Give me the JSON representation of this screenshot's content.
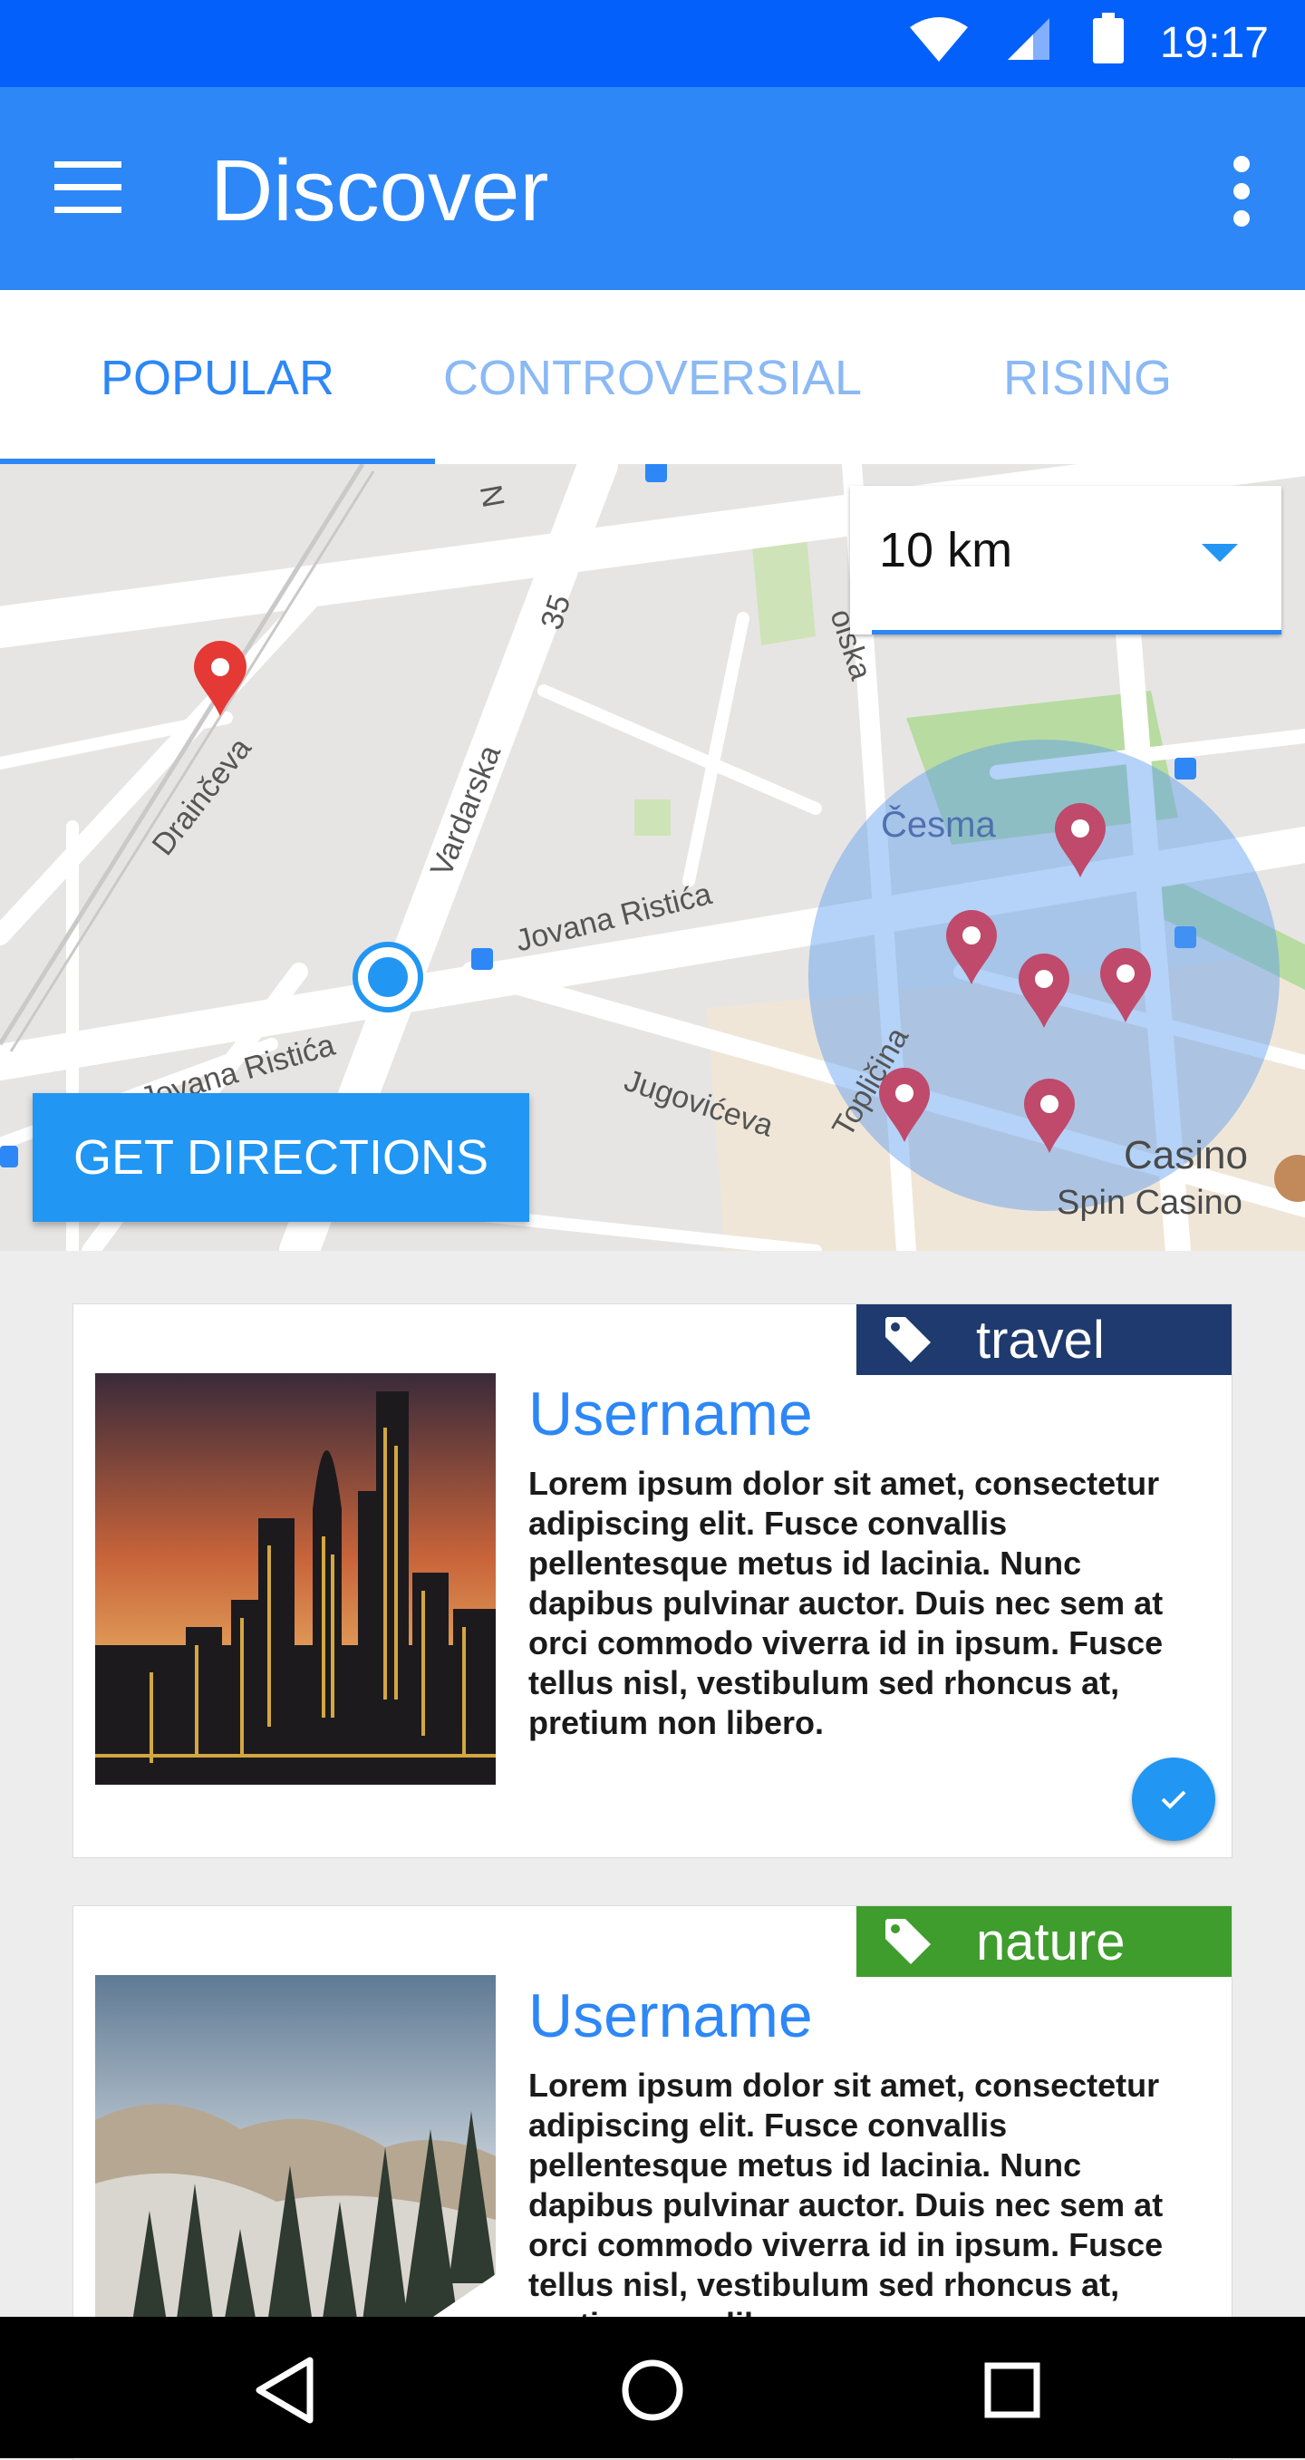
{
  "status_bar": {
    "time": "19:17"
  },
  "app_bar": {
    "title": "Discover"
  },
  "tabs": [
    {
      "label": "POPULAR"
    },
    {
      "label": "CONTROVERSIAL"
    },
    {
      "label": "RISING"
    }
  ],
  "map": {
    "radius_select": {
      "value": "10 km"
    },
    "streets": [
      "Drainčeva",
      "Vardarska",
      "35",
      "Jovana Ristića",
      "Jovana Ristića",
      "Jugovićeva",
      "Topličina",
      "olska",
      "N"
    ],
    "places": [
      "Česma",
      "Casino",
      "Spin Casino"
    ],
    "directions_button": "GET DIRECTIONS"
  },
  "cards": [
    {
      "tag": "travel",
      "tag_color": "#1e3a6e",
      "username": "Username",
      "body": "Lorem ipsum dolor sit amet, consectetur adipiscing elit. Fusce convallis pellentesque metus id lacinia. Nunc dapibus pulvinar auctor. Duis nec sem at orci commodo viverra id in ipsum. Fusce tellus nisl, vestibulum sed rhoncus at, pretium non libero."
    },
    {
      "tag": "nature",
      "tag_color": "#3f9d2e",
      "username": "Username",
      "body": "Lorem ipsum dolor sit amet, consectetur adipiscing elit. Fusce convallis pellentesque metus id lacinia. Nunc dapibus pulvinar auctor. Duis nec sem at orci commodo viverra id in ipsum. Fusce tellus nisl, vestibulum sed rhoncus at, pretium non libero."
    }
  ],
  "colors": {
    "primary": "#2d87f6",
    "status_bar": "#0460fb",
    "accent": "#2196f3"
  }
}
